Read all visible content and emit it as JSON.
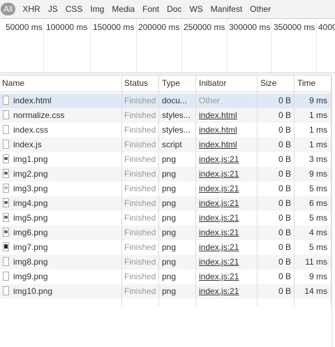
{
  "filters": [
    "All",
    "XHR",
    "JS",
    "CSS",
    "Img",
    "Media",
    "Font",
    "Doc",
    "WS",
    "Manifest",
    "Other"
  ],
  "timeline_ticks": [
    "50000 ms",
    "100000 ms",
    "150000 ms",
    "200000 ms",
    "250000 ms",
    "300000 ms",
    "350000 ms",
    "4000"
  ],
  "columns": {
    "name": "Name",
    "status": "Status",
    "type": "Type",
    "initiator": "Initiator",
    "size": "Size",
    "time": "Time"
  },
  "rows": [
    {
      "name": "index.html",
      "status": "Finished",
      "type": "docu...",
      "initiator": "Other",
      "size": "0 B",
      "time": "9 ms",
      "icon": "document-icon"
    },
    {
      "name": "normalize.css",
      "status": "Finished",
      "type": "styles...",
      "initiator": "index.html",
      "size": "0 B",
      "time": "1 ms",
      "icon": "document-icon"
    },
    {
      "name": "index.css",
      "status": "Finished",
      "type": "styles...",
      "initiator": "index.html",
      "size": "0 B",
      "time": "1 ms",
      "icon": "document-icon"
    },
    {
      "name": "index.js",
      "status": "Finished",
      "type": "script",
      "initiator": "index.html",
      "size": "0 B",
      "time": "1 ms",
      "icon": "document-icon"
    },
    {
      "name": "img1.png",
      "status": "Finished",
      "type": "png",
      "initiator": "index.js:21",
      "size": "0 B",
      "time": "3 ms",
      "icon": "image-icon"
    },
    {
      "name": "img2.png",
      "status": "Finished",
      "type": "png",
      "initiator": "index.js:21",
      "size": "0 B",
      "time": "9 ms",
      "icon": "image-icon"
    },
    {
      "name": "img3.png",
      "status": "Finished",
      "type": "png",
      "initiator": "index.js:21",
      "size": "0 B",
      "time": "5 ms",
      "icon": "image-icon"
    },
    {
      "name": "img4.png",
      "status": "Finished",
      "type": "png",
      "initiator": "index.js:21",
      "size": "0 B",
      "time": "6 ms",
      "icon": "image-icon"
    },
    {
      "name": "img5.png",
      "status": "Finished",
      "type": "png",
      "initiator": "index.js:21",
      "size": "0 B",
      "time": "5 ms",
      "icon": "image-icon"
    },
    {
      "name": "img6.png",
      "status": "Finished",
      "type": "png",
      "initiator": "index.js:21",
      "size": "0 B",
      "time": "4 ms",
      "icon": "image-icon"
    },
    {
      "name": "img7.png",
      "status": "Finished",
      "type": "png",
      "initiator": "index.js:21",
      "size": "0 B",
      "time": "5 ms",
      "icon": "image-icon"
    },
    {
      "name": "img8.png",
      "status": "Finished",
      "type": "png",
      "initiator": "index.js:21",
      "size": "0 B",
      "time": "11 ms",
      "icon": "document-icon"
    },
    {
      "name": "img9.png",
      "status": "Finished",
      "type": "png",
      "initiator": "index.js:21",
      "size": "0 B",
      "time": "9 ms",
      "icon": "document-icon"
    },
    {
      "name": "img10.png",
      "status": "Finished",
      "type": "png",
      "initiator": "index.js:21",
      "size": "0 B",
      "time": "14 ms",
      "icon": "document-icon"
    }
  ],
  "colors": {
    "selected_row": "#dfe9f6",
    "active_filter": "#999999",
    "muted_text": "#999999"
  }
}
